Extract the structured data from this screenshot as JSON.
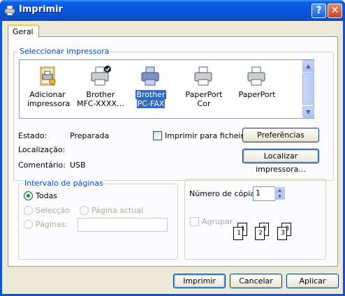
{
  "window": {
    "title": "Imprimir",
    "help_glyph": "?",
    "close_glyph": "✕"
  },
  "tabs": [
    {
      "label": "Geral"
    }
  ],
  "select_printer": {
    "group_label": "Seleccionar impressora",
    "printers": [
      {
        "name_line1": "Adicionar",
        "name_line2": "impressora",
        "icon": "add-printer-icon"
      },
      {
        "name_line1": "Brother",
        "name_line2": "MFC-XXXX…",
        "icon": "printer-default-icon"
      },
      {
        "name_line1": "Brother",
        "name_line2": "PC-FAX",
        "icon": "printer-icon",
        "selected": true
      },
      {
        "name_line1": "PaperPort Cor",
        "name_line2": "",
        "icon": "printer-icon"
      },
      {
        "name_line1": "PaperPort",
        "name_line2": "",
        "icon": "printer-icon"
      }
    ],
    "status_label": "Estado:",
    "status_value": "Preparada",
    "location_label": "Localização:",
    "location_value": "",
    "comment_label": "Comentário:",
    "comment_value": "USB",
    "print_to_file_label": "Imprimir para ficheiro",
    "preferences_button": "Preferências",
    "find_printer_button": "Localizar impressora..."
  },
  "page_range": {
    "group_label": "Intervalo de páginas",
    "all_label": "Todas",
    "selection_label": "Selecção",
    "current_page_label": "Página actual",
    "pages_label": "Páginas:",
    "pages_value": ""
  },
  "copies": {
    "label": "Número de cópias:",
    "value": "1",
    "collate_label": "Agrupar",
    "collate_pages": [
      "1",
      "1",
      "2",
      "2",
      "3",
      "3"
    ]
  },
  "buttons": {
    "print": "Imprimir",
    "cancel": "Cancelar",
    "apply": "Aplicar"
  },
  "colors": {
    "titlebar": "#0753d6",
    "group_label": "#0046d5",
    "selection": "#316ac5",
    "radio_dot": "#21a121"
  }
}
